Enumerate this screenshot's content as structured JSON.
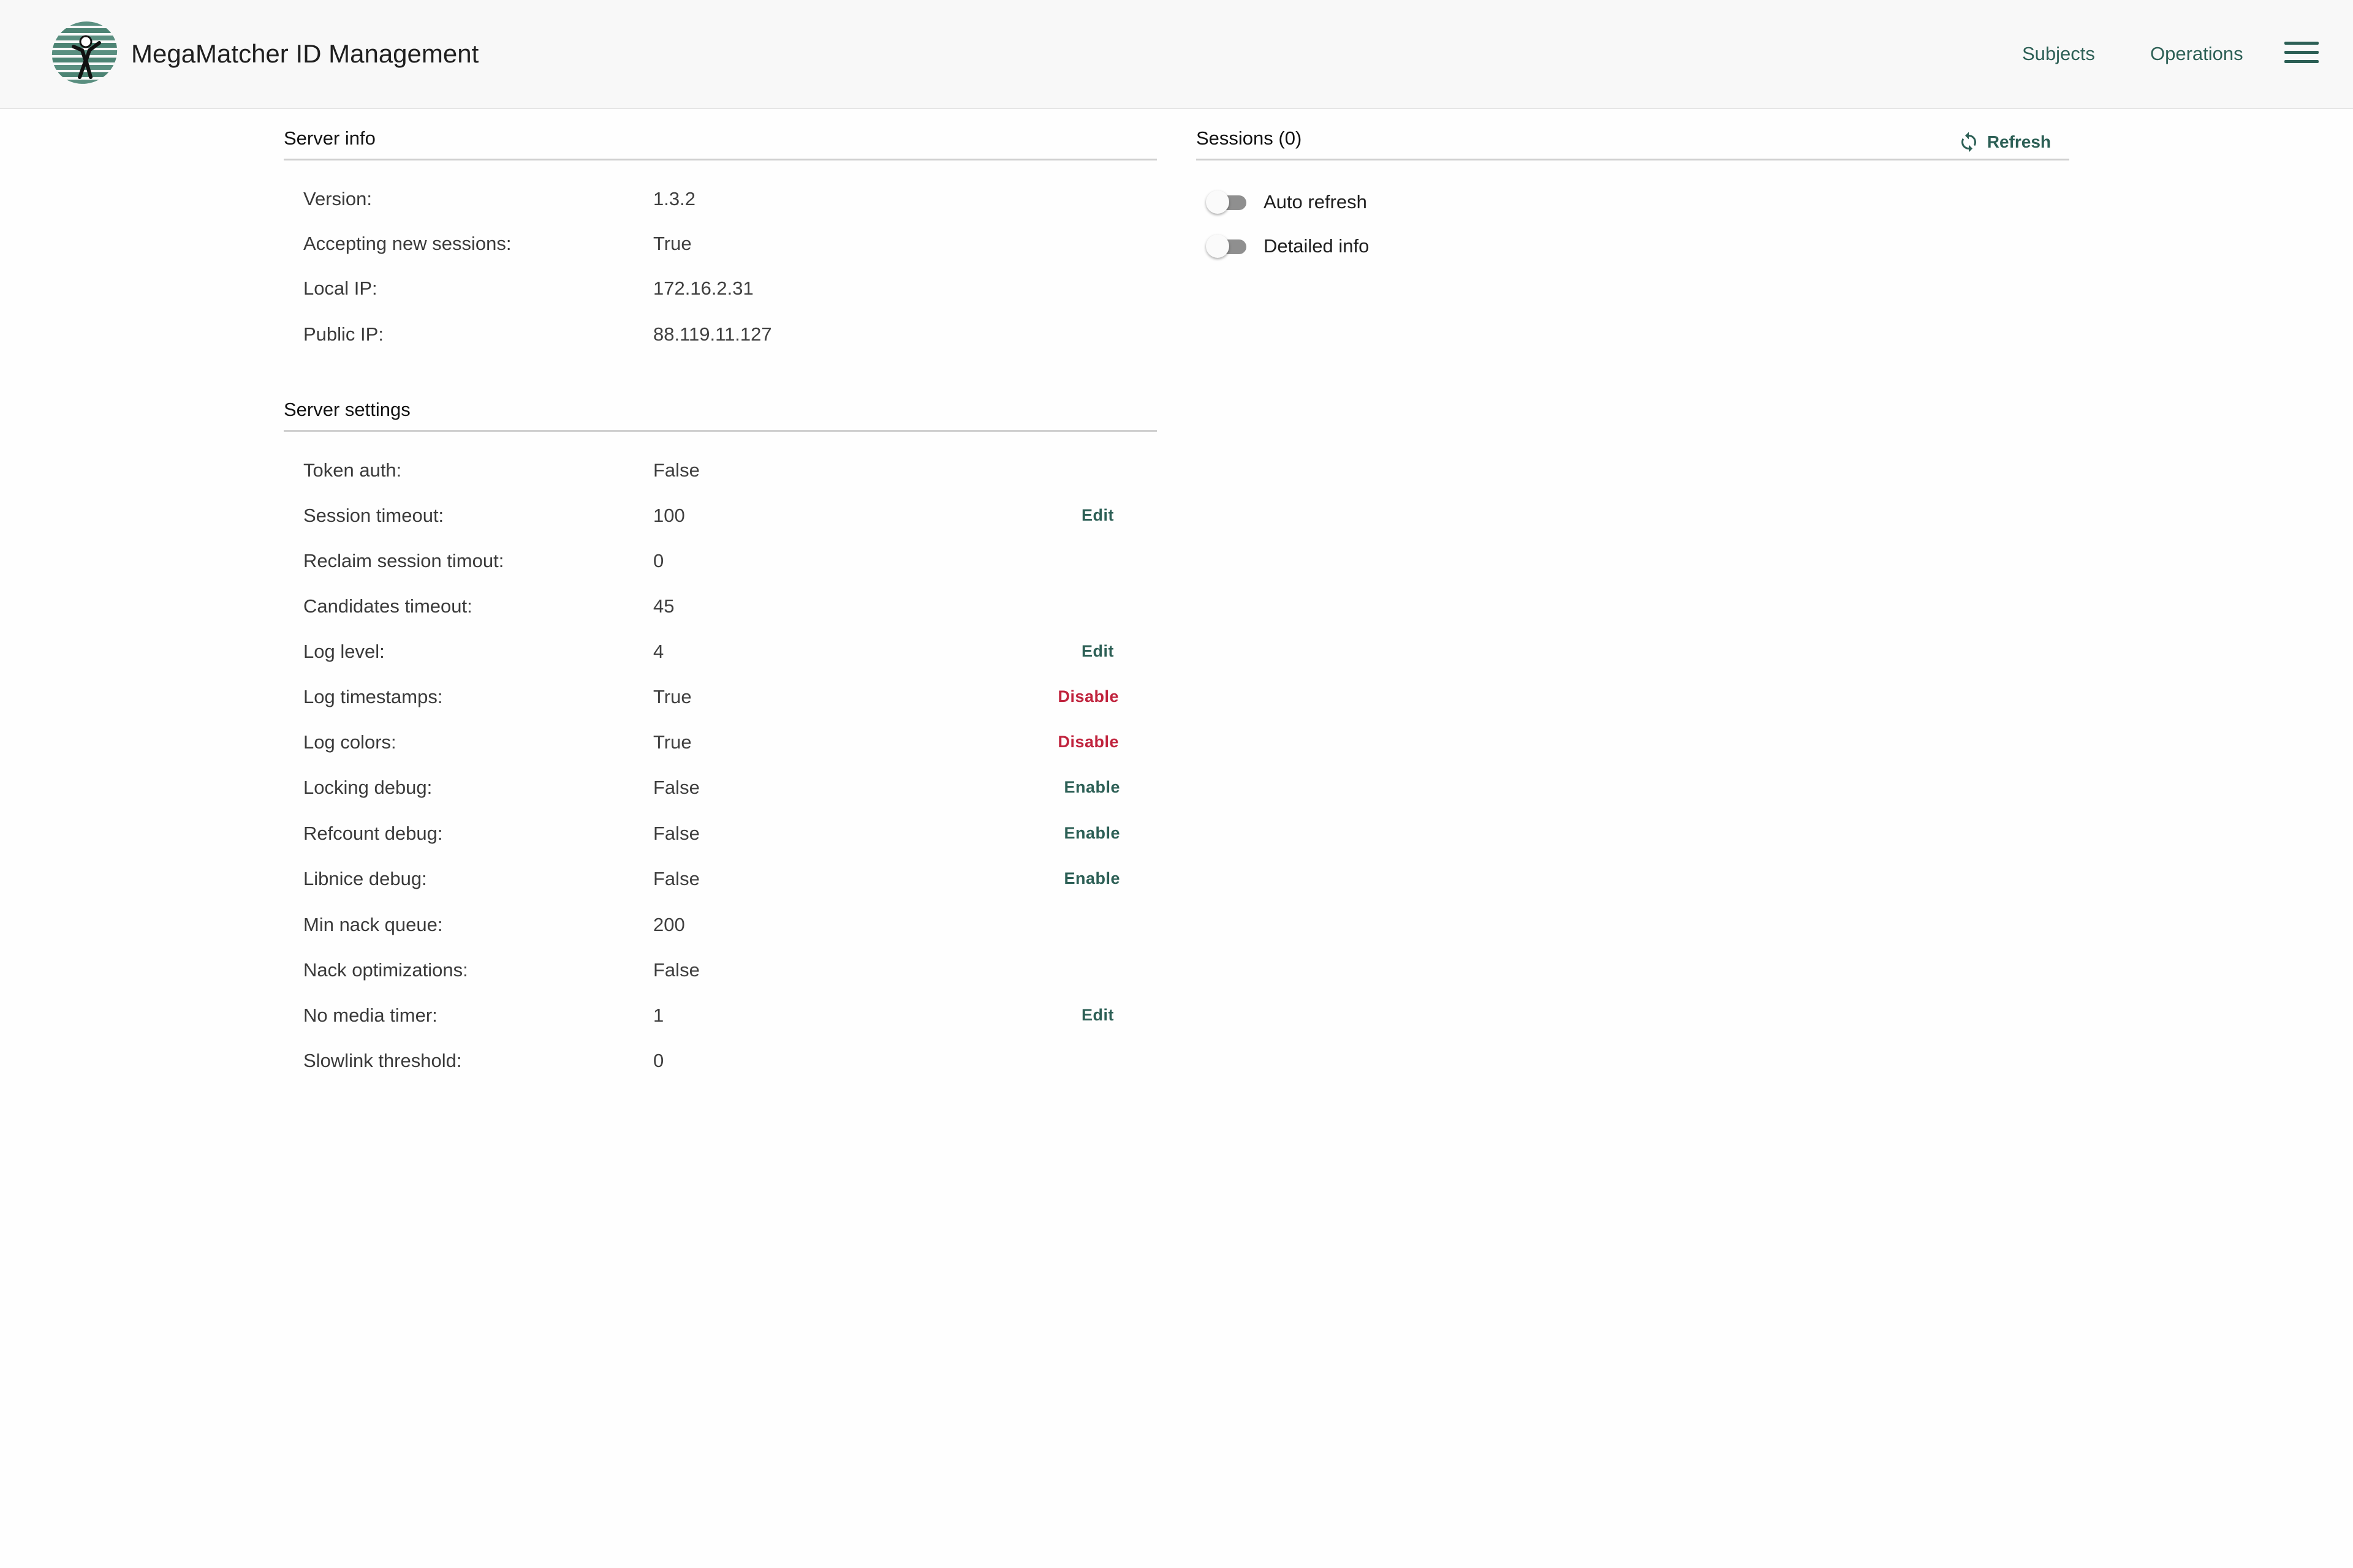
{
  "header": {
    "app_title": "MegaMatcher ID Management",
    "nav": [
      {
        "label": "Subjects"
      },
      {
        "label": "Operations"
      }
    ]
  },
  "server_info": {
    "title": "Server info",
    "rows": [
      {
        "label": "Version:",
        "value": "1.3.2"
      },
      {
        "label": "Accepting new sessions:",
        "value": "True"
      },
      {
        "label": "Local IP:",
        "value": "172.16.2.31"
      },
      {
        "label": "Public IP:",
        "value": "88.119.11.127"
      }
    ]
  },
  "server_settings": {
    "title": "Server settings",
    "rows": [
      {
        "label": "Token auth:",
        "value": "False",
        "action": ""
      },
      {
        "label": "Session timeout:",
        "value": "100",
        "action": "Edit"
      },
      {
        "label": "Reclaim session timout:",
        "value": "0",
        "action": ""
      },
      {
        "label": "Candidates timeout:",
        "value": "45",
        "action": ""
      },
      {
        "label": "Log level:",
        "value": "4",
        "action": "Edit"
      },
      {
        "label": "Log timestamps:",
        "value": "True",
        "action": "Disable"
      },
      {
        "label": "Log colors:",
        "value": "True",
        "action": "Disable"
      },
      {
        "label": "Locking debug:",
        "value": "False",
        "action": "Enable"
      },
      {
        "label": "Refcount debug:",
        "value": "False",
        "action": "Enable"
      },
      {
        "label": "Libnice debug:",
        "value": "False",
        "action": "Enable"
      },
      {
        "label": "Min nack queue:",
        "value": "200",
        "action": ""
      },
      {
        "label": "Nack optimizations:",
        "value": "False",
        "action": ""
      },
      {
        "label": "No media timer:",
        "value": "1",
        "action": "Edit"
      },
      {
        "label": "Slowlink threshold:",
        "value": "0",
        "action": ""
      }
    ]
  },
  "sessions": {
    "title": "Sessions (0)",
    "refresh_label": "Refresh",
    "toggles": [
      {
        "label": "Auto refresh",
        "on": false
      },
      {
        "label": "Detailed info",
        "on": false
      }
    ]
  },
  "colors": {
    "accent": "#2c5f55",
    "danger": "#c0233d",
    "header_bg": "#f8f8f8"
  },
  "icons": {
    "logo": "biometric-figure-logo",
    "menu": "hamburger-menu-icon",
    "refresh": "refresh-icon"
  }
}
